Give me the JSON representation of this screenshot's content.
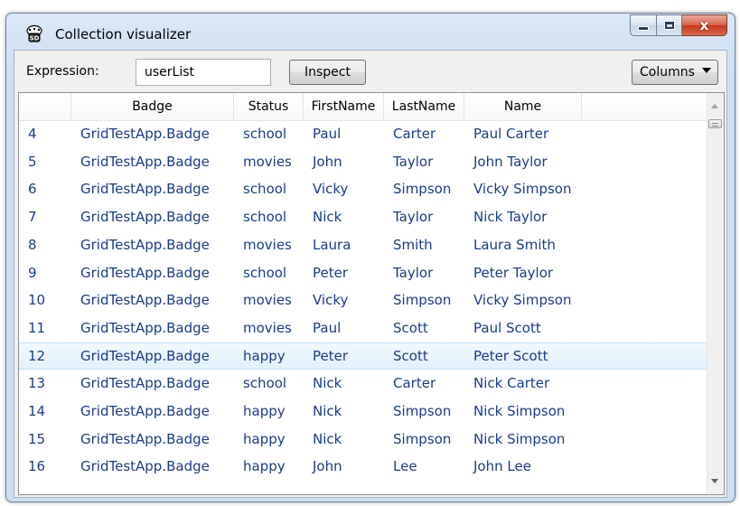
{
  "window": {
    "title": "Collection visualizer",
    "close_glyph": "x"
  },
  "toolbar": {
    "expression_label": "Expression:",
    "expression_value": "userList",
    "inspect_label": "Inspect",
    "columns_label": "Columns"
  },
  "grid": {
    "columns": [
      "",
      "Badge",
      "Status",
      "FirstName",
      "LastName",
      "Name",
      ""
    ],
    "rows": [
      [
        "4",
        "GridTestApp.Badge",
        "school",
        "Paul",
        "Carter",
        "Paul Carter"
      ],
      [
        "5",
        "GridTestApp.Badge",
        "movies",
        "John",
        "Taylor",
        "John Taylor"
      ],
      [
        "6",
        "GridTestApp.Badge",
        "school",
        "Vicky",
        "Simpson",
        "Vicky Simpson"
      ],
      [
        "7",
        "GridTestApp.Badge",
        "school",
        "Nick",
        "Taylor",
        "Nick Taylor"
      ],
      [
        "8",
        "GridTestApp.Badge",
        "movies",
        "Laura",
        "Smith",
        "Laura Smith"
      ],
      [
        "9",
        "GridTestApp.Badge",
        "school",
        "Peter",
        "Taylor",
        "Peter Taylor"
      ],
      [
        "10",
        "GridTestApp.Badge",
        "movies",
        "Vicky",
        "Simpson",
        "Vicky Simpson"
      ],
      [
        "11",
        "GridTestApp.Badge",
        "movies",
        "Paul",
        "Scott",
        "Paul Scott"
      ],
      [
        "12",
        "GridTestApp.Badge",
        "happy",
        "Peter",
        "Scott",
        "Peter Scott"
      ],
      [
        "13",
        "GridTestApp.Badge",
        "school",
        "Nick",
        "Carter",
        "Nick Carter"
      ],
      [
        "14",
        "GridTestApp.Badge",
        "happy",
        "Nick",
        "Simpson",
        "Nick Simpson"
      ],
      [
        "15",
        "GridTestApp.Badge",
        "happy",
        "Nick",
        "Simpson",
        "Nick Simpson"
      ],
      [
        "16",
        "GridTestApp.Badge",
        "happy",
        "John",
        "Lee",
        "John Lee"
      ]
    ],
    "selected_row": 8
  },
  "icons": {
    "app": "app-icon",
    "minimize": "minimize-icon",
    "maximize": "maximize-icon",
    "close": "close-icon",
    "dropdown": "chevron-down-icon"
  },
  "colors": {
    "row_text": "#1a3c8c",
    "selected_row": "#e2f1fb",
    "close_button": "#c4391c"
  }
}
